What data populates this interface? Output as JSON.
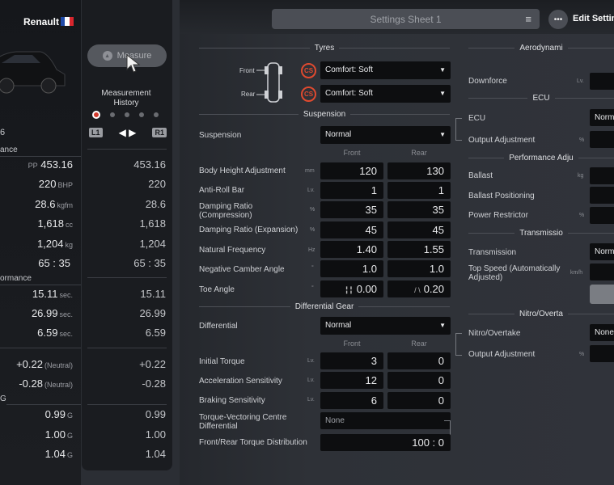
{
  "car": {
    "name": "Renault",
    "flag_colors": [
      "#1f4aa8",
      "#ffffff",
      "#d8262d"
    ]
  },
  "left": {
    "row_6": "6",
    "sec1_label": "ance",
    "sec2_label": "ormance",
    "sec3_label": "G",
    "pp": {
      "prefix": "PP",
      "value": "453.16"
    },
    "power": {
      "value": "220",
      "unit": "BHP"
    },
    "torque": {
      "value": "28.6",
      "unit": "kgfm"
    },
    "displacement": {
      "value": "1,618",
      "unit": "cc"
    },
    "weight": {
      "value": "1,204",
      "unit": "kg"
    },
    "ratio": "65 : 35",
    "t1": {
      "value": "15.11",
      "unit": "sec."
    },
    "t2": {
      "value": "26.99",
      "unit": "sec."
    },
    "t3": {
      "value": "6.59",
      "unit": "sec."
    },
    "b1": {
      "value": "+0.22",
      "unit": "(Neutral)"
    },
    "b2": {
      "value": "-0.28",
      "unit": "(Neutral)"
    },
    "g1": {
      "value": "0.99",
      "unit": "G"
    },
    "g2": {
      "value": "1.00",
      "unit": "G"
    },
    "g3": {
      "value": "1.04",
      "unit": "G"
    }
  },
  "history": {
    "measure_label": "Measure",
    "title": "Measurement History",
    "l1": "L1",
    "r1": "R1",
    "values": [
      "453.16",
      "220",
      "28.6",
      "1,618",
      "1,204",
      "65 : 35",
      "15.11",
      "26.99",
      "6.59",
      "+0.22",
      "-0.28",
      "0.99",
      "1.00",
      "1.04"
    ]
  },
  "topbar": {
    "sheet": "Settings Sheet 1",
    "edit": "Edit Setting"
  },
  "tyres": {
    "section": "Tyres",
    "front_label": "Front",
    "rear_label": "Rear",
    "cs": "CS",
    "front_value": "Comfort: Soft",
    "rear_value": "Comfort: Soft"
  },
  "suspension": {
    "section": "Suspension",
    "label": "Suspension",
    "value": "Normal",
    "col_front": "Front",
    "col_rear": "Rear",
    "rows": [
      {
        "label": "Body Height Adjustment",
        "unit": "mm",
        "front": "120",
        "rear": "130"
      },
      {
        "label": "Anti-Roll Bar",
        "unit": "Lv.",
        "front": "1",
        "rear": "1"
      },
      {
        "label": "Damping Ratio (Compression)",
        "unit": "%",
        "front": "35",
        "rear": "35"
      },
      {
        "label": "Damping Ratio (Expansion)",
        "unit": "%",
        "front": "45",
        "rear": "45"
      },
      {
        "label": "Natural Frequency",
        "unit": "Hz",
        "front": "1.40",
        "rear": "1.55"
      },
      {
        "label": "Negative Camber Angle",
        "unit": "°",
        "front": "1.0",
        "rear": "1.0"
      },
      {
        "label": "Toe Angle",
        "unit": "°",
        "front": "0.00",
        "rear": "0.20"
      }
    ]
  },
  "differential": {
    "section": "Differential Gear",
    "label": "Differential",
    "value": "Normal",
    "col_front": "Front",
    "col_rear": "Rear",
    "rows": [
      {
        "label": "Initial Torque",
        "unit": "Lv.",
        "front": "3",
        "rear": "0"
      },
      {
        "label": "Acceleration Sensitivity",
        "unit": "Lv.",
        "front": "12",
        "rear": "0"
      },
      {
        "label": "Braking Sensitivity",
        "unit": "Lv.",
        "front": "6",
        "rear": "0"
      }
    ],
    "tv_label": "Torque-Vectoring Centre Differential",
    "tv_value": "None",
    "dist_label": "Front/Rear Torque Distribution",
    "dist_value": "100 : 0"
  },
  "right": {
    "aero_section": "Aerodynami",
    "downforce_label": "Downforce",
    "downforce_unit": "Lv.",
    "ecu_section": "ECU",
    "ecu_label": "ECU",
    "ecu_value": "Norm",
    "output_label": "Output Adjustment",
    "output_unit": "%",
    "perf_section": "Performance Adju",
    "ballast_label": "Ballast",
    "ballast_unit": "kg",
    "ballast_pos_label": "Ballast Positioning",
    "restrictor_label": "Power Restrictor",
    "restrictor_unit": "%",
    "trans_section": "Transmissio",
    "trans_label": "Transmission",
    "trans_value": "Norm",
    "topspeed_label": "Top Speed (Automatically Adjusted)",
    "topspeed_unit": "km/h",
    "nitro_section": "Nitro/Overta",
    "nitro_label": "Nitro/Overtake",
    "nitro_value": "None",
    "nitro_output_label": "Output Adjustment",
    "nitro_output_unit": "%"
  }
}
